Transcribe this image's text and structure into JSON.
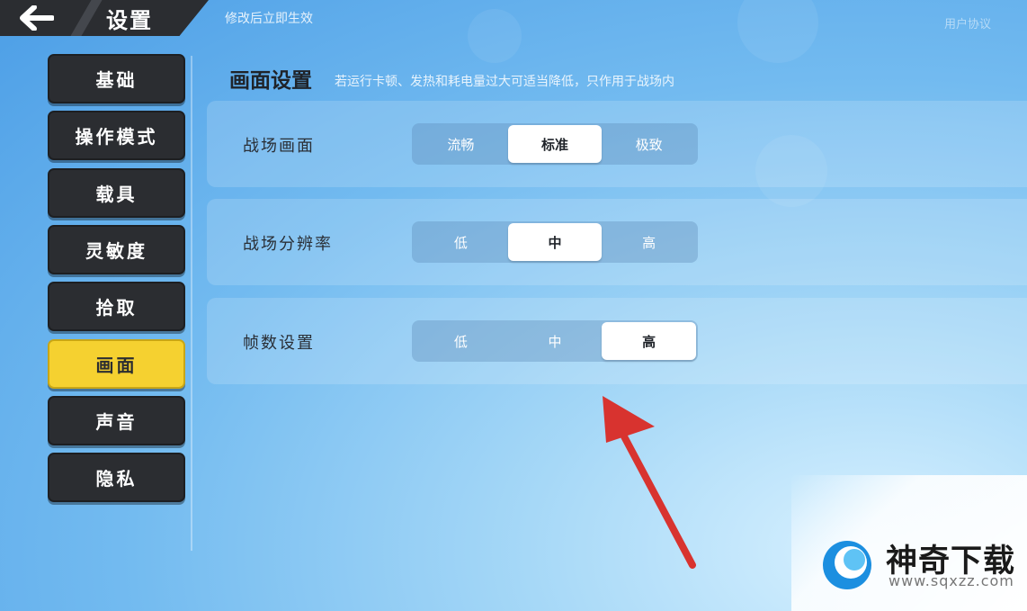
{
  "header": {
    "title": "设置",
    "note": "修改后立即生效",
    "right_link": "用户协议"
  },
  "sidebar": {
    "items": [
      {
        "label": "基础",
        "active": false
      },
      {
        "label": "操作模式",
        "active": false
      },
      {
        "label": "载具",
        "active": false
      },
      {
        "label": "灵敏度",
        "active": false
      },
      {
        "label": "拾取",
        "active": false
      },
      {
        "label": "画面",
        "active": true
      },
      {
        "label": "声音",
        "active": false
      },
      {
        "label": "隐私",
        "active": false
      }
    ]
  },
  "main": {
    "title": "画面设置",
    "hint": "若运行卡顿、发热和耗电量过大可适当降低，只作用于战场内",
    "settings": [
      {
        "label": "战场画面",
        "options": [
          "流畅",
          "标准",
          "极致"
        ],
        "selected": "标准"
      },
      {
        "label": "战场分辨率",
        "options": [
          "低",
          "中",
          "高"
        ],
        "selected": "中"
      },
      {
        "label": "帧数设置",
        "options": [
          "低",
          "中",
          "高"
        ],
        "selected": "高"
      }
    ]
  },
  "watermark": {
    "brand": "神奇下载",
    "url": "www.sqxzz.com"
  },
  "colors": {
    "active_tab": "#f5d130",
    "tab_dark": "#2b2d31",
    "arrow": "#d8332f"
  },
  "icons": {
    "back": "back-arrow-icon",
    "logo": "sqxzz-logo-icon"
  }
}
